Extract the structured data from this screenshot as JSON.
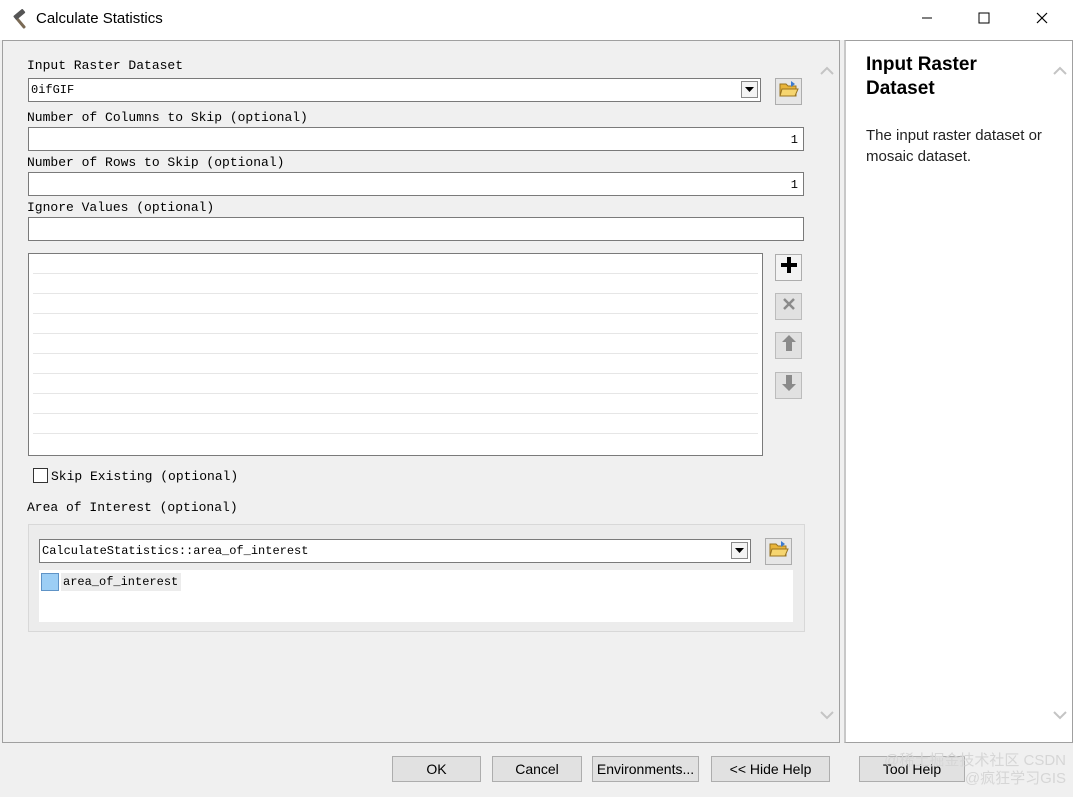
{
  "window": {
    "title": "Calculate Statistics"
  },
  "form": {
    "input_raster": {
      "label": "Input Raster Dataset",
      "value": "0ifGIF"
    },
    "columns_skip": {
      "label": "Number of Columns to Skip (optional)",
      "value": "1"
    },
    "rows_skip": {
      "label": "Number of Rows to Skip (optional)",
      "value": "1"
    },
    "ignore_values": {
      "label": "Ignore Values (optional)",
      "value": "",
      "list_items": []
    },
    "skip_existing": {
      "label": "Skip Existing (optional)",
      "checked": false
    },
    "area_of_interest": {
      "label": "Area of Interest (optional)",
      "value": "CalculateStatistics::area_of_interest",
      "layer_name": "area_of_interest",
      "layer_color": "#9ccef5"
    }
  },
  "help": {
    "title": "Input Raster Dataset",
    "body": "The input raster dataset or mosaic dataset."
  },
  "buttons": {
    "ok": "OK",
    "cancel": "Cancel",
    "environments": "Environments...",
    "hide_help": "<< Hide Help",
    "tool_help": "Tool Help"
  },
  "watermark": "@稀土掘金技术社区 CSDN @疯狂学习GIS",
  "icons": {
    "app": "hammer-icon",
    "browse": "open-folder-icon",
    "add": "plus-icon",
    "delete": "x-icon",
    "up": "arrow-up-icon",
    "down": "arrow-down-icon"
  }
}
